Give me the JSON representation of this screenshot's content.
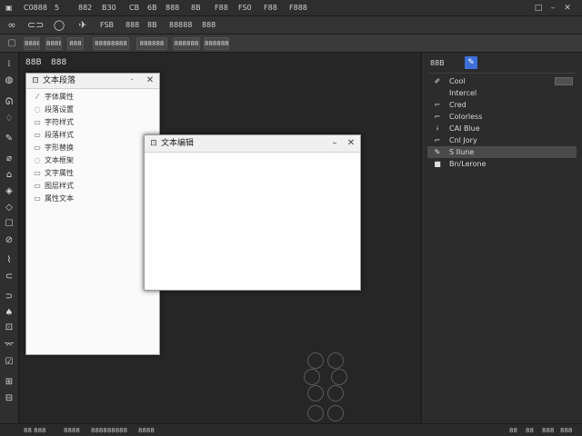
{
  "menubar": {
    "items": [
      "C0888",
      "882",
      "5",
      "",
      "",
      "",
      "",
      "",
      "",
      "",
      "",
      ""
    ],
    "icons": [
      "link-icon",
      "circle-icon",
      "bird-icon"
    ],
    "texts": [
      "B30",
      "CB",
      "6B",
      "888",
      "8B",
      "F88",
      "FS0",
      "F88",
      "F888"
    ],
    "controls": [
      "□",
      "–",
      "✕"
    ]
  },
  "toolbar": {
    "labels": [
      "FSB",
      "888",
      "8B",
      "88888",
      "888"
    ]
  },
  "optionsbar": {
    "buttons": [
      "8888",
      "8888",
      "888",
      "88888888",
      "888888",
      "888888",
      "8888888"
    ]
  },
  "panel_tabs": [
    "88B",
    "888"
  ],
  "list_panel": {
    "title": "文本段落",
    "items": [
      {
        "label": "字体属性"
      },
      {
        "label": "段落设置"
      },
      {
        "label": "字符样式"
      },
      {
        "label": "段落样式"
      },
      {
        "label": "字形替换"
      },
      {
        "label": "文本框架"
      },
      {
        "label": "文字属性"
      },
      {
        "label": "图层样式"
      },
      {
        "label": "属性文本"
      }
    ]
  },
  "dialog": {
    "title": "文本编辑"
  },
  "right_panel": {
    "title": "88B",
    "items": [
      {
        "label": "Cool",
        "icon": "brush-icon"
      },
      {
        "label": "Intercel",
        "icon": "empty-icon"
      },
      {
        "label": "Cred",
        "icon": "frame-icon"
      },
      {
        "label": "Colorless",
        "icon": "frame-icon"
      },
      {
        "label": "CAI Blue",
        "icon": "crop-icon"
      },
      {
        "label": "Cnl Jory",
        "icon": "frame-icon"
      },
      {
        "label": "S Ilune",
        "icon": "pen-icon"
      },
      {
        "label": "Bn/Lerone",
        "icon": "square-icon"
      }
    ]
  },
  "statusbar": {
    "items": [
      "88 888",
      "8888",
      "888888888",
      "8888",
      "88",
      "88",
      "888",
      "888"
    ]
  },
  "colors": {
    "accent": "#3d6fd8",
    "bg": "#232323",
    "panel": "#2c2c2c"
  }
}
